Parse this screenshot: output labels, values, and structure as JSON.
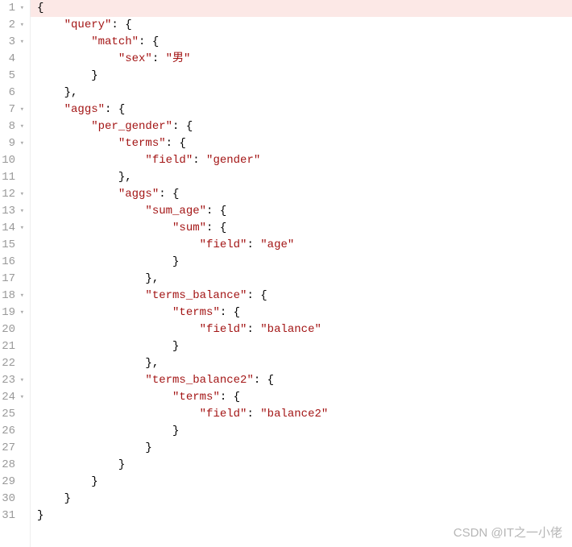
{
  "editor": {
    "highlighted_line": 1,
    "fold_marker": "▾",
    "lines": [
      {
        "num": 1,
        "fold": true,
        "indent": 0,
        "segments": [
          {
            "t": "punct",
            "v": "{"
          }
        ]
      },
      {
        "num": 2,
        "fold": true,
        "indent": 1,
        "segments": [
          {
            "t": "key",
            "v": "\"query\""
          },
          {
            "t": "punct",
            "v": ": {"
          }
        ]
      },
      {
        "num": 3,
        "fold": true,
        "indent": 2,
        "segments": [
          {
            "t": "key",
            "v": "\"match\""
          },
          {
            "t": "punct",
            "v": ": {"
          }
        ]
      },
      {
        "num": 4,
        "fold": false,
        "indent": 3,
        "segments": [
          {
            "t": "key",
            "v": "\"sex\""
          },
          {
            "t": "punct",
            "v": ": "
          },
          {
            "t": "str",
            "v": "\"男\""
          }
        ]
      },
      {
        "num": 5,
        "fold": false,
        "indent": 2,
        "segments": [
          {
            "t": "punct",
            "v": "}"
          }
        ]
      },
      {
        "num": 6,
        "fold": false,
        "indent": 1,
        "segments": [
          {
            "t": "punct",
            "v": "},"
          }
        ]
      },
      {
        "num": 7,
        "fold": true,
        "indent": 1,
        "segments": [
          {
            "t": "key",
            "v": "\"aggs\""
          },
          {
            "t": "punct",
            "v": ": {"
          }
        ]
      },
      {
        "num": 8,
        "fold": true,
        "indent": 2,
        "segments": [
          {
            "t": "key",
            "v": "\"per_gender\""
          },
          {
            "t": "punct",
            "v": ": {"
          }
        ]
      },
      {
        "num": 9,
        "fold": true,
        "indent": 3,
        "segments": [
          {
            "t": "key",
            "v": "\"terms\""
          },
          {
            "t": "punct",
            "v": ": {"
          }
        ]
      },
      {
        "num": 10,
        "fold": false,
        "indent": 4,
        "segments": [
          {
            "t": "key",
            "v": "\"field\""
          },
          {
            "t": "punct",
            "v": ": "
          },
          {
            "t": "str",
            "v": "\"gender\""
          }
        ]
      },
      {
        "num": 11,
        "fold": false,
        "indent": 3,
        "segments": [
          {
            "t": "punct",
            "v": "},"
          }
        ]
      },
      {
        "num": 12,
        "fold": true,
        "indent": 3,
        "segments": [
          {
            "t": "key",
            "v": "\"aggs\""
          },
          {
            "t": "punct",
            "v": ": {"
          }
        ]
      },
      {
        "num": 13,
        "fold": true,
        "indent": 4,
        "segments": [
          {
            "t": "key",
            "v": "\"sum_age\""
          },
          {
            "t": "punct",
            "v": ": {"
          }
        ]
      },
      {
        "num": 14,
        "fold": true,
        "indent": 5,
        "segments": [
          {
            "t": "key",
            "v": "\"sum\""
          },
          {
            "t": "punct",
            "v": ": {"
          }
        ]
      },
      {
        "num": 15,
        "fold": false,
        "indent": 6,
        "segments": [
          {
            "t": "key",
            "v": "\"field\""
          },
          {
            "t": "punct",
            "v": ": "
          },
          {
            "t": "str",
            "v": "\"age\""
          }
        ]
      },
      {
        "num": 16,
        "fold": false,
        "indent": 5,
        "segments": [
          {
            "t": "punct",
            "v": "}"
          }
        ]
      },
      {
        "num": 17,
        "fold": false,
        "indent": 4,
        "segments": [
          {
            "t": "punct",
            "v": "},"
          }
        ]
      },
      {
        "num": 18,
        "fold": true,
        "indent": 4,
        "segments": [
          {
            "t": "key",
            "v": "\"terms_balance\""
          },
          {
            "t": "punct",
            "v": ": {"
          }
        ]
      },
      {
        "num": 19,
        "fold": true,
        "indent": 5,
        "segments": [
          {
            "t": "key",
            "v": "\"terms\""
          },
          {
            "t": "punct",
            "v": ": {"
          }
        ]
      },
      {
        "num": 20,
        "fold": false,
        "indent": 6,
        "segments": [
          {
            "t": "key",
            "v": "\"field\""
          },
          {
            "t": "punct",
            "v": ": "
          },
          {
            "t": "str",
            "v": "\"balance\""
          }
        ]
      },
      {
        "num": 21,
        "fold": false,
        "indent": 5,
        "segments": [
          {
            "t": "punct",
            "v": "}"
          }
        ]
      },
      {
        "num": 22,
        "fold": false,
        "indent": 4,
        "segments": [
          {
            "t": "punct",
            "v": "},"
          }
        ]
      },
      {
        "num": 23,
        "fold": true,
        "indent": 4,
        "segments": [
          {
            "t": "key",
            "v": "\"terms_balance2\""
          },
          {
            "t": "punct",
            "v": ": {"
          }
        ]
      },
      {
        "num": 24,
        "fold": true,
        "indent": 5,
        "segments": [
          {
            "t": "key",
            "v": "\"terms\""
          },
          {
            "t": "punct",
            "v": ": {"
          }
        ]
      },
      {
        "num": 25,
        "fold": false,
        "indent": 6,
        "segments": [
          {
            "t": "key",
            "v": "\"field\""
          },
          {
            "t": "punct",
            "v": ": "
          },
          {
            "t": "str",
            "v": "\"balance2\""
          }
        ]
      },
      {
        "num": 26,
        "fold": false,
        "indent": 5,
        "segments": [
          {
            "t": "punct",
            "v": "}"
          }
        ]
      },
      {
        "num": 27,
        "fold": false,
        "indent": 4,
        "segments": [
          {
            "t": "punct",
            "v": "}"
          }
        ]
      },
      {
        "num": 28,
        "fold": false,
        "indent": 3,
        "segments": [
          {
            "t": "punct",
            "v": "}"
          }
        ]
      },
      {
        "num": 29,
        "fold": false,
        "indent": 2,
        "segments": [
          {
            "t": "punct",
            "v": "}"
          }
        ]
      },
      {
        "num": 30,
        "fold": false,
        "indent": 1,
        "segments": [
          {
            "t": "punct",
            "v": "}"
          }
        ]
      },
      {
        "num": 31,
        "fold": false,
        "indent": 0,
        "segments": [
          {
            "t": "punct",
            "v": "}"
          }
        ]
      }
    ]
  },
  "watermark": "CSDN @IT之一小佬"
}
